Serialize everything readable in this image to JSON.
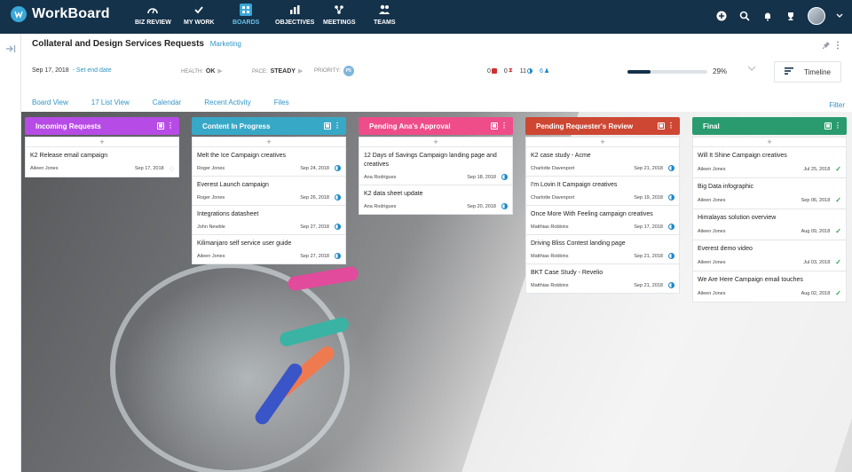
{
  "app": {
    "name": "WorkBoard",
    "nav": [
      {
        "label": "BIZ REVIEW",
        "icon": "gauge-icon"
      },
      {
        "label": "MY WORK",
        "icon": "check-icon"
      },
      {
        "label": "BOARDS",
        "icon": "board-icon",
        "active": true
      },
      {
        "label": "OBJECTIVES",
        "icon": "bar-chart-icon"
      },
      {
        "label": "MEETINGS",
        "icon": "meetings-icon"
      },
      {
        "label": "TEAMS",
        "icon": "teams-icon"
      }
    ]
  },
  "board": {
    "title": "Collateral and Design Services Requests",
    "team": "Marketing",
    "start_date": "Sep 17, 2018",
    "end_date_link": "- Set end date",
    "health_label": "HEALTH:",
    "health_value": "OK",
    "pace_label": "PACE:",
    "pace_value": "STEADY",
    "priority_label": "PRIORITY:",
    "priority_value": "P5",
    "counts": {
      "overdue": "0",
      "late": "0",
      "in_progress": "11",
      "people": "6"
    },
    "progress_percent": 29,
    "progress_text": "29%",
    "timeline_label": "Timeline"
  },
  "tabs": [
    "Board View",
    "17 List View",
    "Calendar",
    "Recent Activity",
    "Files"
  ],
  "filter_label": "Filter",
  "add_symbol": "+",
  "colors": {
    "topbar": "#14324a",
    "accent": "#2f95c6",
    "col_incoming": "#b74be6",
    "col_progress": "#38a8c7",
    "col_approval": "#ee4d89",
    "col_review": "#cd4733",
    "col_final": "#2a9b6e"
  },
  "columns": [
    {
      "title": "Incoming Requests",
      "color": "#b74be6",
      "cards": [
        {
          "title": "K2 Release email campaign",
          "owner": "Aileen Jones",
          "date": "Sep 17, 2018",
          "status": "empty"
        }
      ]
    },
    {
      "title": "Content In Progress",
      "color": "#38a8c7",
      "cards": [
        {
          "title": "Melt the Ice Campaign creatives",
          "owner": "Roger Jones",
          "date": "Sep 24, 2018",
          "status": "half"
        },
        {
          "title": "Everest Launch campaign",
          "owner": "Roger Jones",
          "date": "Sep 26, 2018",
          "status": "half"
        },
        {
          "title": "Integrations datasheet",
          "owner": "John Newble",
          "date": "Sep 27, 2018",
          "status": "half"
        },
        {
          "title": "Kilimanjaro self service user guide",
          "owner": "Aileen Jones",
          "date": "Sep 27, 2018",
          "status": "half"
        }
      ]
    },
    {
      "title": "Pending Ana's Approval",
      "color": "#ee4d89",
      "cards": [
        {
          "title": "12 Days of Savings Campaign landing page and creatives",
          "owner": "Ana Rodrigues",
          "date": "Sep 18, 2018",
          "status": "half"
        },
        {
          "title": "K2 data sheet update",
          "owner": "Ana Rodrigues",
          "date": "Sep 20, 2018",
          "status": "half"
        }
      ]
    },
    {
      "title": "Pending Requester's Review",
      "color": "#cd4733",
      "cards": [
        {
          "title": "K2 case study - Acme",
          "owner": "Charlotte Davenport",
          "date": "Sep 21, 2018",
          "status": "half"
        },
        {
          "title": "I'm Lovin It Campaign creatives",
          "owner": "Charlotte Davenport",
          "date": "Sep 19, 2018",
          "status": "half"
        },
        {
          "title": "Once More With Feeling campaign creatives",
          "owner": "Matthias Robbins",
          "date": "Sep 17, 2018",
          "status": "half"
        },
        {
          "title": "Driving Bliss Contest landing page",
          "owner": "Matthias Robbins",
          "date": "Sep 21, 2018",
          "status": "half"
        },
        {
          "title": "BKT Case Study - Revelio",
          "owner": "Matthias Robbins",
          "date": "Sep 21, 2018",
          "status": "half"
        }
      ]
    },
    {
      "title": "Final",
      "color": "#2a9b6e",
      "cards": [
        {
          "title": "Will It Shine Campaign creatives",
          "owner": "Aileen Jones",
          "date": "Jul 25, 2018",
          "status": "done"
        },
        {
          "title": "Big Data infographic",
          "owner": "Aileen Jones",
          "date": "Sep 06, 2018",
          "status": "done"
        },
        {
          "title": "Himalayas solution overview",
          "owner": "Aileen Jones",
          "date": "Aug 09, 2018",
          "status": "done"
        },
        {
          "title": "Everest demo video",
          "owner": "Aileen Jones",
          "date": "Jul 03, 2018",
          "status": "done"
        },
        {
          "title": "We Are Here Campaign email touches",
          "owner": "Aileen Jones",
          "date": "Aug 02, 2018",
          "status": "done"
        }
      ]
    }
  ]
}
